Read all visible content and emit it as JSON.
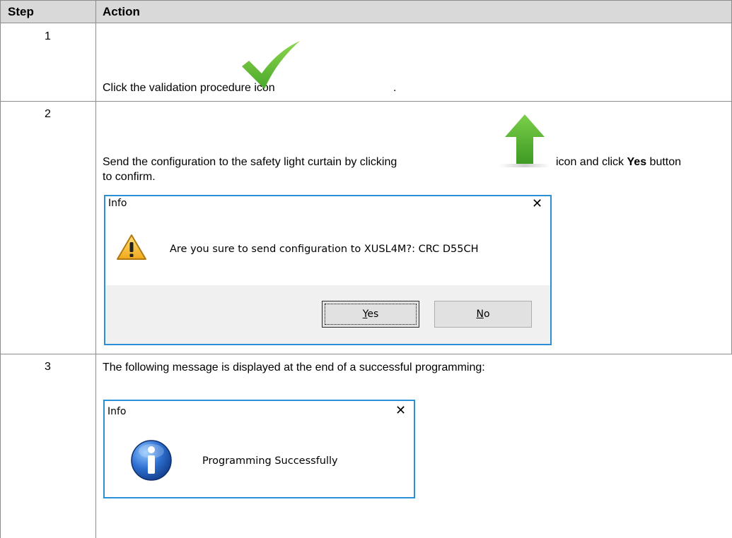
{
  "table": {
    "header_step": "Step",
    "header_action": "Action"
  },
  "rows": [
    {
      "step": "1",
      "text": "Click the validation procedure icon",
      "text_tail": ".",
      "icon": "checkmark-icon"
    },
    {
      "step": "2",
      "text_a": "Send the configuration to the safety light curtain by clicking",
      "text_b": "icon and click",
      "bold": "Yes",
      "text_c": "button",
      "text_d": "to confirm.",
      "icon": "upload-arrow-icon",
      "dialog": {
        "title": "Info",
        "message": "Are you sure to send configuration to XUSL4M?: CRC D55CH",
        "yes_accel": "Y",
        "yes_rest": "es",
        "no_accel": "N",
        "no_rest": "o",
        "icon": "warning-icon"
      }
    },
    {
      "step": "3",
      "text": "The following message is displayed at the end of a successful programming:",
      "dialog": {
        "title": "Info",
        "message": "Programming Successfully",
        "icon": "info-icon"
      }
    }
  ],
  "colors": {
    "header_bg": "#d9d9d9",
    "border": "#8c8c8c",
    "dialog_border": "#2b8fd6",
    "check_green": "#6dc23a",
    "arrow_green": "#5fb83a"
  }
}
